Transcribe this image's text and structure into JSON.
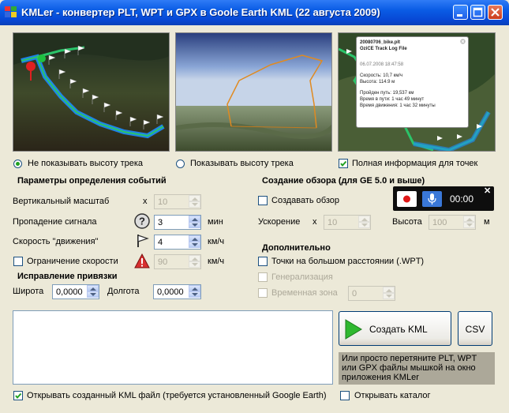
{
  "window": {
    "title": "KMLer - конвертер PLT, WPT и GPX в Goole Earth KML (22 августа 2009)",
    "title_colors": {
      "bar": "#0A5CE5",
      "close": "#D9522F"
    }
  },
  "preview": {
    "popup_title": "20080706_bike.plt",
    "popup_subtitle": "OziCE Track Log File",
    "popup_date": "06.07.2008 18:47:58",
    "popup_speed": "Скорость: 10,7 км/ч",
    "popup_height": "Высота: 114.9 м",
    "popup_distance": "Пройден путь: 19,537 км",
    "popup_time_total": "Время в пути: 1 час 49 минут",
    "popup_time_moving": "Время движения: 1 час 32 минуты"
  },
  "display": {
    "no_height_label": "Не показывать высоту трека",
    "show_height_label": "Показывать высоту трека",
    "full_info_label": "Полная информация для точек",
    "selected": "no_height",
    "full_info_checked": true
  },
  "events": {
    "heading": "Параметры определения событий",
    "vscale_label": "Вертикальный масштаб",
    "vscale_prefix": "x",
    "vscale_value": "10",
    "signal_loss_label": "Пропадение сигнала",
    "signal_loss_value": "3",
    "signal_loss_unit": "мин",
    "speed_label": "Скорость \"движения\"",
    "speed_value": "4",
    "speed_unit": "км/ч",
    "speed_limit_label": "Ограничение скорости",
    "speed_limit_value": "90",
    "speed_limit_unit": "км/ч",
    "speed_limit_checked": false
  },
  "correction": {
    "heading": "Исправление привязки",
    "lat_label": "Широта",
    "lat_value": "0,0000",
    "lon_label": "Долгота",
    "lon_value": "0,0000"
  },
  "overview": {
    "heading": "Создание обзора (для GE 5.0 и выше)",
    "create_label": "Создавать обзор",
    "create_checked": false,
    "accel_label": "Ускорение",
    "accel_prefix": "x",
    "accel_value": "10",
    "height_label": "Высота",
    "height_value": "100",
    "height_unit": "м"
  },
  "recorder": {
    "time": "00:00",
    "close": "✕"
  },
  "extra": {
    "heading": "Дополнительно",
    "far_points_label": "Точки на большом расстоянии (.WPT)",
    "generalize_label": "Генерализация",
    "timezone_label": "Временная зона",
    "timezone_value": "0"
  },
  "actions": {
    "create_kml_label": "Создать KML",
    "csv_label": "CSV",
    "hint": "Или просто перетяните PLT, WPT или GPX файлы мышкой на окно приложения KMLer",
    "open_kml_label": "Открывать созданный KML файл (требуется установленный Google Earth)",
    "open_kml_checked": true,
    "open_folder_label": "Открывать каталог",
    "open_folder_checked": false
  }
}
